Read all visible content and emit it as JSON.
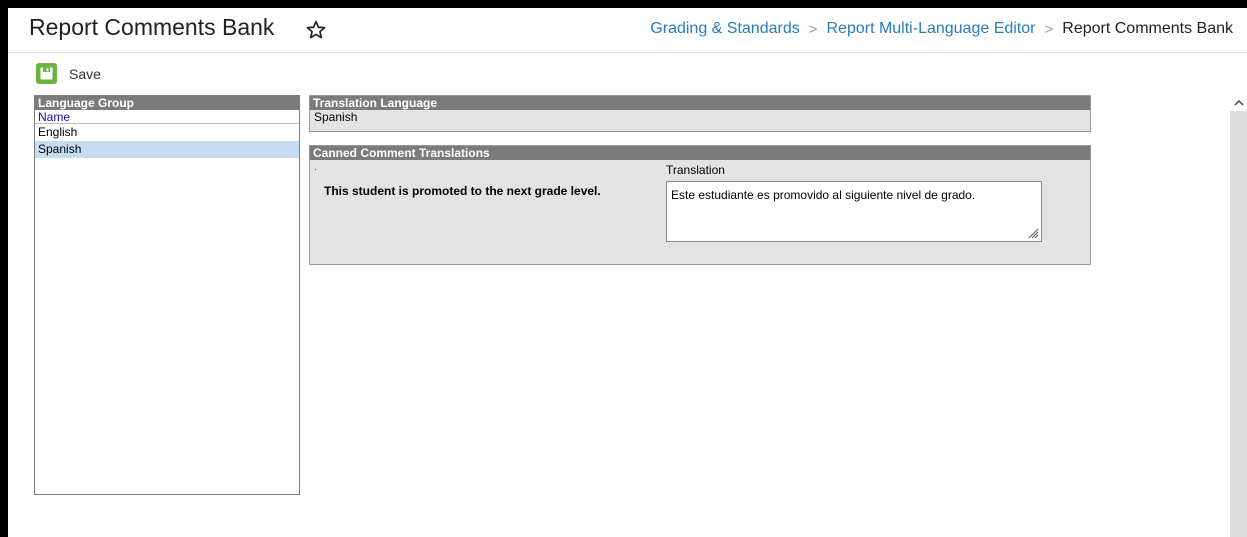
{
  "header": {
    "title": "Report Comments Bank",
    "breadcrumbs": [
      {
        "label": "Grading & Standards"
      },
      {
        "label": "Report Multi-Language Editor"
      },
      {
        "label": "Report Comments Bank"
      }
    ],
    "separator": ">"
  },
  "toolbar": {
    "save_label": "Save"
  },
  "language_group": {
    "header": "Language Group",
    "column_header": "Name",
    "items": [
      {
        "label": "English",
        "selected": false
      },
      {
        "label": "Spanish",
        "selected": true
      }
    ]
  },
  "translation_language": {
    "header": "Translation Language",
    "value": "Spanish"
  },
  "canned_comments": {
    "header": "Canned Comment Translations",
    "marker": ".",
    "translation_label": "Translation",
    "comment": "This student is promoted to the next grade level.",
    "translation": "Este estudiante es promovido al siguiente nivel de grado."
  },
  "colors": {
    "accent": "#2b7bbd",
    "save_green": "#6ab43e",
    "panel_header": "#7b7b7b",
    "selected_row": "#c5dcf1"
  },
  "icons": {
    "favorite": "star-outline-icon",
    "save": "floppy-disk-icon",
    "scroll_up": "chevron-up-icon",
    "resize": "resize-grip-icon"
  }
}
